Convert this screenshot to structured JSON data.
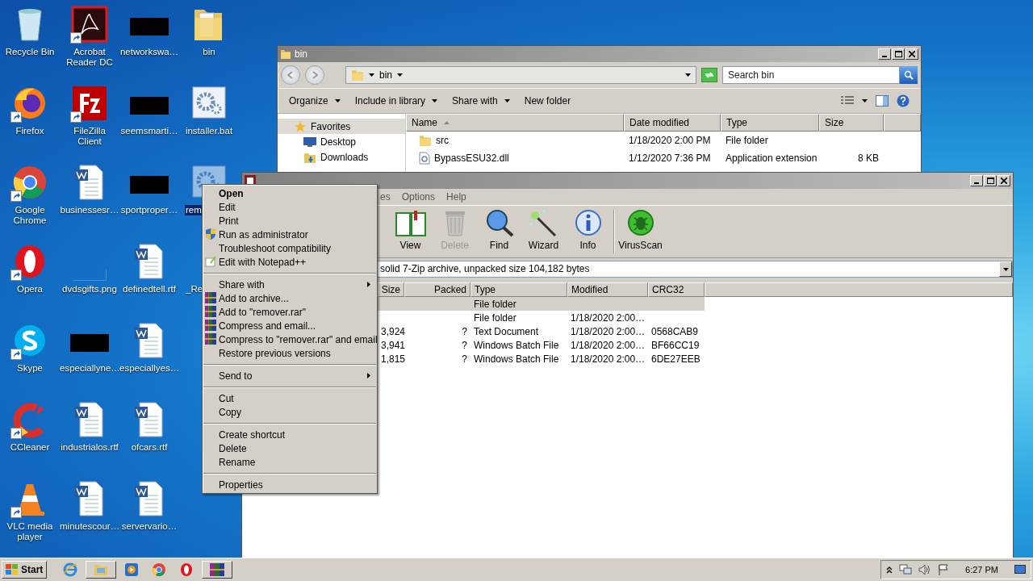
{
  "desktop": {
    "icons": [
      {
        "label": "Recycle Bin",
        "kind": "recycle",
        "shortcut": false,
        "selected": false
      },
      {
        "label": "Firefox",
        "kind": "firefox",
        "shortcut": true,
        "selected": false
      },
      {
        "label": "Google Chrome",
        "kind": "chrome",
        "shortcut": true,
        "selected": false
      },
      {
        "label": "Opera",
        "kind": "opera",
        "shortcut": true,
        "selected": false
      },
      {
        "label": "Skype",
        "kind": "skype",
        "shortcut": true,
        "selected": false
      },
      {
        "label": "CCleaner",
        "kind": "ccleaner",
        "shortcut": true,
        "selected": false
      },
      {
        "label": "VLC media player",
        "kind": "vlc",
        "shortcut": true,
        "selected": false
      },
      {
        "label": "Acrobat Reader DC",
        "kind": "pdf",
        "shortcut": true,
        "selected": false
      },
      {
        "label": "FileZilla Client",
        "kind": "filezilla",
        "shortcut": true,
        "selected": false
      },
      {
        "label": "businessesr…",
        "kind": "word",
        "shortcut": false,
        "selected": false
      },
      {
        "label": "dvdsgifts.png",
        "kind": "blank",
        "shortcut": false,
        "selected": false
      },
      {
        "label": "especiallyne…",
        "kind": "black",
        "shortcut": false,
        "selected": false
      },
      {
        "label": "industrialos.rtf",
        "kind": "word",
        "shortcut": false,
        "selected": false
      },
      {
        "label": "minutescour…",
        "kind": "word",
        "shortcut": false,
        "selected": false
      },
      {
        "label": "networkswa…",
        "kind": "black",
        "shortcut": false,
        "selected": false
      },
      {
        "label": "seemsmarti…",
        "kind": "black",
        "shortcut": false,
        "selected": false
      },
      {
        "label": "sportproper…",
        "kind": "black",
        "shortcut": false,
        "selected": false
      },
      {
        "label": "definedtell.rtf",
        "kind": "word",
        "shortcut": false,
        "selected": false
      },
      {
        "label": "especiallyes…",
        "kind": "word",
        "shortcut": false,
        "selected": false
      },
      {
        "label": "ofcars.rtf",
        "kind": "word",
        "shortcut": false,
        "selected": false
      },
      {
        "label": "servervario…",
        "kind": "word",
        "shortcut": false,
        "selected": false
      },
      {
        "label": "bin",
        "kind": "folder",
        "shortcut": false,
        "selected": false
      },
      {
        "label": "installer.bat",
        "kind": "gear",
        "shortcut": false,
        "selected": false
      },
      {
        "label": "rem",
        "kind": "gear",
        "shortcut": false,
        "selected": true
      },
      {
        "label": "_Re",
        "kind": "none",
        "shortcut": false,
        "selected": false
      }
    ]
  },
  "explorer": {
    "title": "bin",
    "address": "bin",
    "search": {
      "placeholder": "Search bin"
    },
    "commands": [
      {
        "label": "Organize",
        "dropdown": true
      },
      {
        "label": "Include in library",
        "dropdown": true
      },
      {
        "label": "Share with",
        "dropdown": true
      },
      {
        "label": "New folder",
        "dropdown": false
      }
    ],
    "nav": [
      {
        "label": "Favorites",
        "kind": "star",
        "selected": true
      },
      {
        "label": "Desktop",
        "kind": "desktop",
        "selected": false
      },
      {
        "label": "Downloads",
        "kind": "downloads",
        "selected": false
      }
    ],
    "columns": [
      "Name",
      "Date modified",
      "Type",
      "Size"
    ],
    "rows": [
      {
        "kind": "folder",
        "name": "src",
        "date": "1/18/2020 2:00 PM",
        "type": "File folder",
        "size": ""
      },
      {
        "kind": "dll",
        "name": "BypassESU32.dll",
        "date": "1/12/2020 7:36 PM",
        "type": "Application extension",
        "size": "8 KB"
      }
    ]
  },
  "archive": {
    "menu": [
      "es",
      "Options",
      "Help"
    ],
    "toolbar": [
      {
        "label": "View",
        "kind": "book",
        "disabled": false
      },
      {
        "label": "Delete",
        "kind": "trash",
        "disabled": true
      },
      {
        "label": "Find",
        "kind": "find",
        "disabled": false
      },
      {
        "label": "Wizard",
        "kind": "wand",
        "disabled": false
      },
      {
        "label": "Info",
        "kind": "info",
        "disabled": false
      },
      {
        "label": "VirusScan",
        "kind": "bug",
        "disabled": false
      }
    ],
    "address": "solid 7-Zip archive, unpacked size 104,182 bytes",
    "columns": [
      "Size",
      "Packed",
      "Type",
      "Modified",
      "CRC32"
    ],
    "rows": [
      {
        "size": "",
        "packed": "",
        "type": "File folder",
        "modified": "",
        "crc": "",
        "selected": true
      },
      {
        "size": "",
        "packed": "",
        "type": "File folder",
        "modified": "1/18/2020 2:00…",
        "crc": "",
        "selected": false
      },
      {
        "size": "3,924",
        "packed": "?",
        "type": "Text Document",
        "modified": "1/18/2020 2:00…",
        "crc": "0568CAB9",
        "selected": false
      },
      {
        "size": "3,941",
        "packed": "?",
        "type": "Windows Batch File",
        "modified": "1/18/2020 2:00…",
        "crc": "BF66CC19",
        "selected": false
      },
      {
        "size": "1,815",
        "packed": "?",
        "type": "Windows Batch File",
        "modified": "1/18/2020 2:00…",
        "crc": "6DE27EEB",
        "selected": false
      }
    ]
  },
  "context_menu": [
    {
      "kind": "plain",
      "label": "Open",
      "default": true,
      "submenu": false
    },
    {
      "kind": "plain",
      "label": "Edit",
      "default": false,
      "submenu": false
    },
    {
      "kind": "plain",
      "label": "Print",
      "default": false,
      "submenu": false
    },
    {
      "kind": "shield",
      "label": "Run as administrator",
      "default": false,
      "submenu": false
    },
    {
      "kind": "plain",
      "label": "Troubleshoot compatibility",
      "default": false,
      "submenu": false
    },
    {
      "kind": "notepad",
      "label": "Edit with Notepad++",
      "default": false,
      "submenu": false
    },
    {
      "kind": "separator"
    },
    {
      "kind": "plain",
      "label": "Share with",
      "default": false,
      "submenu": true
    },
    {
      "kind": "rar",
      "label": "Add to archive...",
      "default": false,
      "submenu": false
    },
    {
      "kind": "rar",
      "label": "Add to \"remover.rar\"",
      "default": false,
      "submenu": false
    },
    {
      "kind": "rar",
      "label": "Compress and email...",
      "default": false,
      "submenu": false
    },
    {
      "kind": "rar",
      "label": "Compress to \"remover.rar\" and email",
      "default": false,
      "submenu": false
    },
    {
      "kind": "plain",
      "label": "Restore previous versions",
      "default": false,
      "submenu": false
    },
    {
      "kind": "separator"
    },
    {
      "kind": "plain",
      "label": "Send to",
      "default": false,
      "submenu": true
    },
    {
      "kind": "separator"
    },
    {
      "kind": "plain",
      "label": "Cut",
      "default": false,
      "submenu": false
    },
    {
      "kind": "plain",
      "label": "Copy",
      "default": false,
      "submenu": false
    },
    {
      "kind": "separator"
    },
    {
      "kind": "plain",
      "label": "Create shortcut",
      "default": false,
      "submenu": false
    },
    {
      "kind": "plain",
      "label": "Delete",
      "default": false,
      "submenu": false
    },
    {
      "kind": "plain",
      "label": "Rename",
      "default": false,
      "submenu": false
    },
    {
      "kind": "separator"
    },
    {
      "kind": "plain",
      "label": "Properties",
      "default": false,
      "submenu": false
    }
  ],
  "taskbar": {
    "start": "Start",
    "apps": [
      {
        "kind": "ie"
      },
      {
        "kind": "explorer"
      },
      {
        "kind": "media"
      },
      {
        "kind": "chrome"
      },
      {
        "kind": "opera"
      },
      {
        "kind": "rar"
      }
    ],
    "clock": "6:27 PM"
  }
}
